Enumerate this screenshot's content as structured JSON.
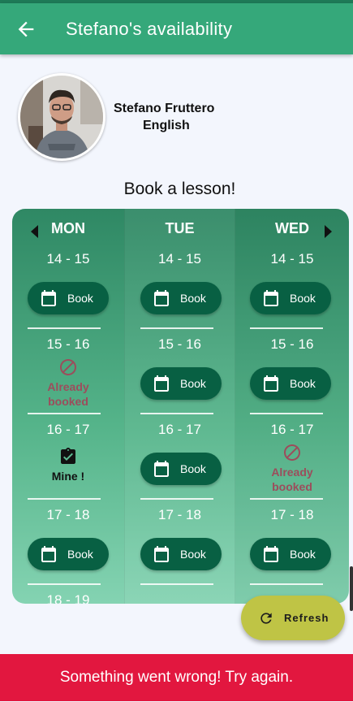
{
  "appbar": {
    "title": "Stefano's  availability",
    "back_icon": "arrow-left-icon",
    "color": "#35a87a"
  },
  "teacher": {
    "name": "Stefano Fruttero",
    "language": "English"
  },
  "heading": "Book a lesson!",
  "calendar": {
    "days": [
      {
        "label": "MON",
        "slots": [
          {
            "time": "14 - 15",
            "status": "book",
            "label": "Book"
          },
          {
            "time": "15 - 16",
            "status": "booked",
            "label": "Already booked"
          },
          {
            "time": "16 - 17",
            "status": "mine",
            "label": "Mine !"
          },
          {
            "time": "17 - 18",
            "status": "book",
            "label": "Book"
          },
          {
            "time": "18 - 19"
          }
        ]
      },
      {
        "label": "TUE",
        "slots": [
          {
            "time": "14 - 15",
            "status": "book",
            "label": "Book"
          },
          {
            "time": "15 - 16",
            "status": "book",
            "label": "Book"
          },
          {
            "time": "16 - 17",
            "status": "book",
            "label": "Book"
          },
          {
            "time": "17 - 18",
            "status": "book",
            "label": "Book"
          }
        ]
      },
      {
        "label": "WED",
        "slots": [
          {
            "time": "14 - 15",
            "status": "book",
            "label": "Book"
          },
          {
            "time": "15 - 16",
            "status": "book",
            "label": "Book"
          },
          {
            "time": "16 - 17",
            "status": "booked",
            "label": "Already booked"
          },
          {
            "time": "17 - 18",
            "status": "book",
            "label": "Book"
          }
        ]
      }
    ],
    "booked_line1": "Already",
    "booked_line2": "booked",
    "accent": "#086043",
    "booked_color": "#9c4d5c"
  },
  "refresh": {
    "label": "Refresh",
    "icon": "refresh-icon",
    "color": "#bfc445"
  },
  "snackbar": {
    "message": "Something went wrong! Try again.",
    "color": "#e2173f"
  }
}
